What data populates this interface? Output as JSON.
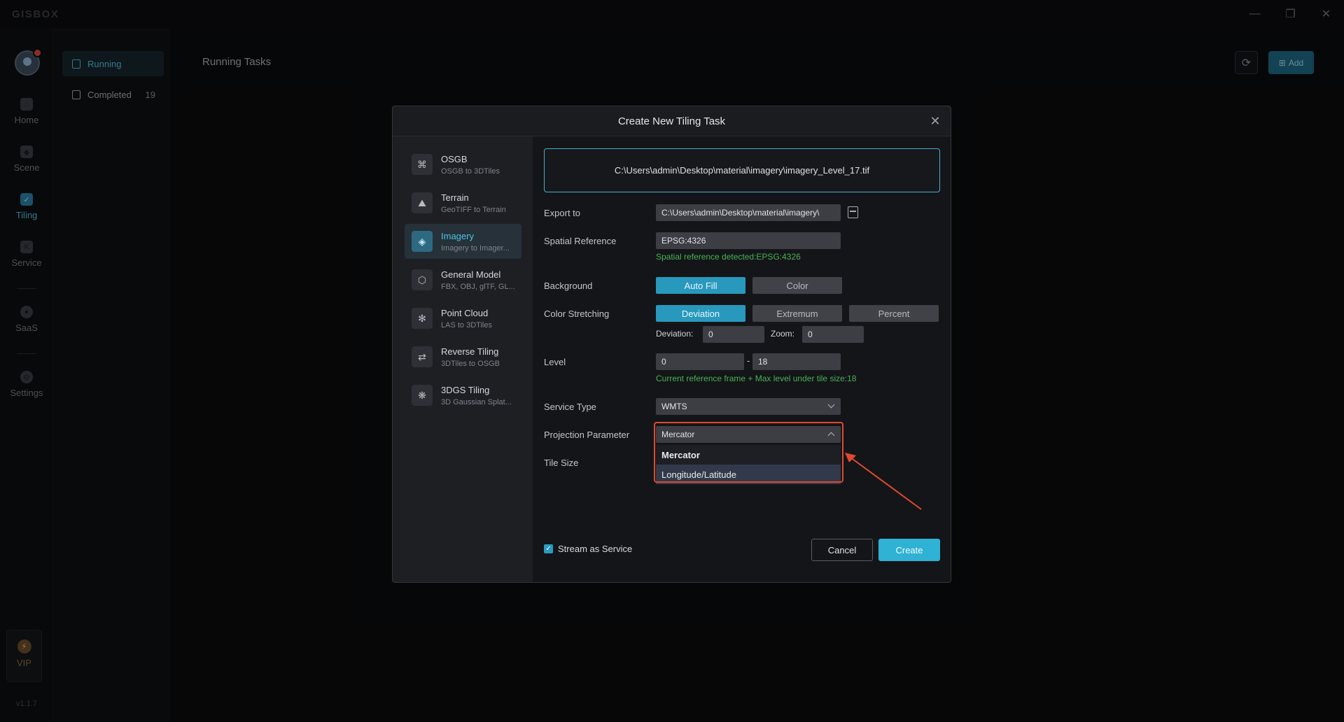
{
  "app": {
    "logo": "GISBOX",
    "version": "v1.1.7"
  },
  "window_controls": {
    "minimize": "—",
    "restore": "❐",
    "close": "✕"
  },
  "nav": {
    "items": [
      {
        "label": "Home",
        "icon": "home-icon"
      },
      {
        "label": "Scene",
        "icon": "scene-icon"
      },
      {
        "label": "Tiling",
        "icon": "tiling-icon",
        "active": true
      },
      {
        "label": "Service",
        "icon": "service-icon"
      },
      {
        "label": "SaaS",
        "icon": "saas-icon"
      },
      {
        "label": "Settings",
        "icon": "settings-icon"
      }
    ],
    "vip_label": "VIP"
  },
  "subnav": {
    "running_label": "Running",
    "completed_label": "Completed",
    "completed_count": "19"
  },
  "main": {
    "title": "Running Tasks",
    "add_label": "Add"
  },
  "dialog": {
    "title": "Create New Tiling Task",
    "task_types": [
      {
        "name": "OSGB",
        "sub": "OSGB to 3DTiles",
        "icon": "osgb-icon"
      },
      {
        "name": "Terrain",
        "sub": "GeoTIFF to Terrain",
        "icon": "terrain-icon"
      },
      {
        "name": "Imagery",
        "sub": "Imagery to Imager...",
        "icon": "imagery-icon",
        "active": true
      },
      {
        "name": "General Model",
        "sub": "FBX, OBJ, glTF, GL...",
        "icon": "model-icon"
      },
      {
        "name": "Point Cloud",
        "sub": "LAS to 3DTiles",
        "icon": "point-cloud-icon"
      },
      {
        "name": "Reverse Tiling",
        "sub": "3DTiles to OSGB",
        "icon": "reverse-tiling-icon"
      },
      {
        "name": "3DGS Tiling",
        "sub": "3D Gaussian Splat...",
        "icon": "3dgs-icon"
      }
    ],
    "file_path": "C:\\Users\\admin\\Desktop\\material\\imagery\\imagery_Level_17.tif",
    "export_label": "Export to",
    "export_value": "C:\\Users\\admin\\Desktop\\material\\imagery\\",
    "spatial_label": "Spatial Reference",
    "spatial_value": "EPSG:4326",
    "spatial_hint": "Spatial reference detected:EPSG:4326",
    "background_label": "Background",
    "background_options": [
      "Auto Fill",
      "Color"
    ],
    "stretch_label": "Color Stretching",
    "stretch_options": [
      "Deviation",
      "Extremum",
      "Percent"
    ],
    "deviation_label": "Deviation:",
    "deviation_value": "0",
    "zoom_label": "Zoom:",
    "zoom_value": "0",
    "level_label": "Level",
    "level_min": "0",
    "level_dash": "-",
    "level_max": "18",
    "level_hint": "Current reference frame + Max level under tile size:18",
    "service_type_label": "Service Type",
    "service_type_value": "WMTS",
    "projection_label": "Projection Parameter",
    "projection_value": "Mercator",
    "projection_options": [
      "Mercator",
      "Longitude/Latitude"
    ],
    "tile_size_label": "Tile Size",
    "stream_label": "Stream as Service",
    "stream_checked": true,
    "cancel_label": "Cancel",
    "create_label": "Create"
  },
  "colors": {
    "accent": "#2998bd",
    "highlight": "#e04a2f",
    "hint_green": "#47b357"
  }
}
